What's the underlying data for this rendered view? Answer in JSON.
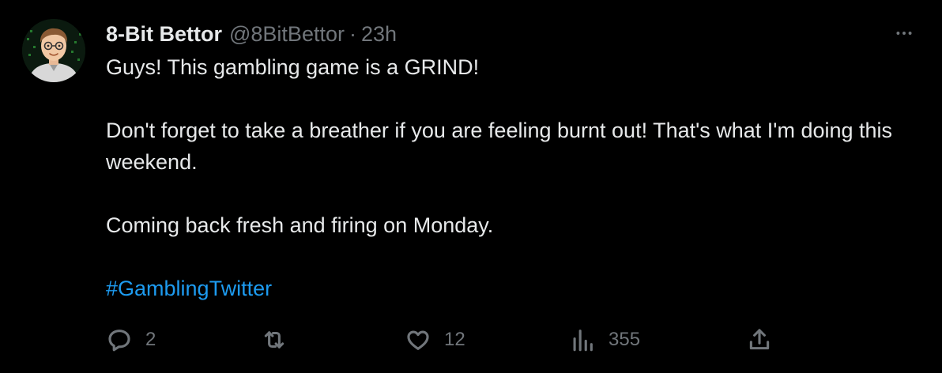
{
  "author": {
    "display_name": "8-Bit Bettor",
    "handle": "@8BitBettor",
    "separator": "·",
    "timestamp": "23h"
  },
  "body": {
    "line1": "Guys! This gambling game is a GRIND!",
    "line2": "Don't forget to take a breather if you are feeling burnt out! That's what I'm doing this weekend.",
    "line3": "Coming back fresh and firing on Monday.",
    "hashtag": "#GamblingTwitter"
  },
  "actions": {
    "reply_icon": "reply-bubble-icon",
    "reply_count": "2",
    "retweet_icon": "retweet-icon",
    "retweet_count": "",
    "like_icon": "heart-icon",
    "like_count": "12",
    "views_icon": "bar-chart-icon",
    "views_count": "355",
    "share_icon": "share-upload-icon"
  },
  "menu": {
    "more_icon": "ellipsis-icon"
  },
  "colors": {
    "background": "#000000",
    "primary_text": "#e7e9ea",
    "secondary_text": "#71767b",
    "link": "#1d9bf0"
  }
}
